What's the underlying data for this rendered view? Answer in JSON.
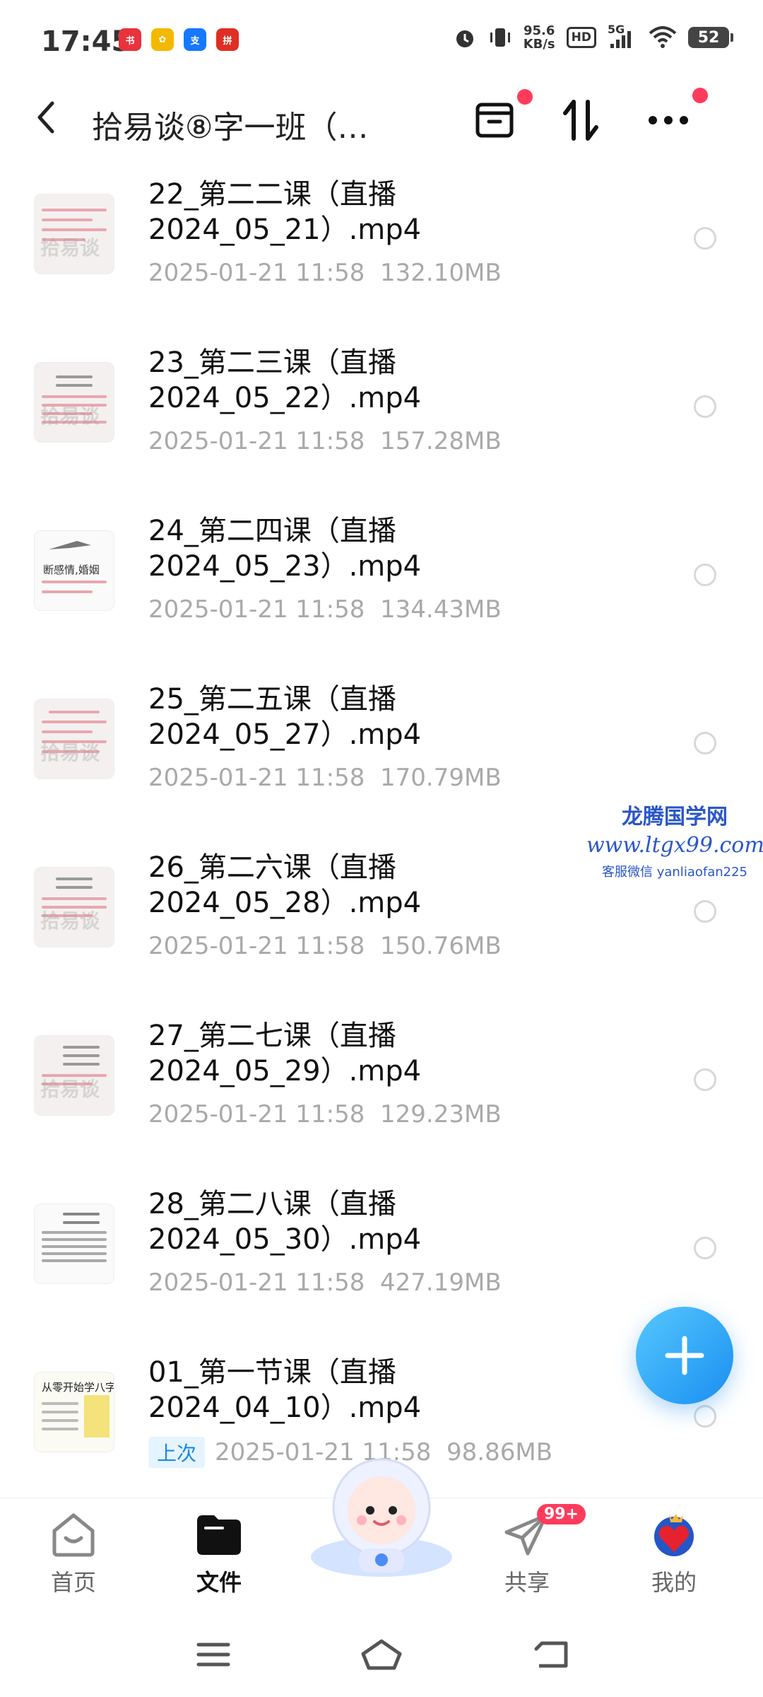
{
  "status": {
    "time": "17:45",
    "speed_value": "95.6",
    "speed_unit": "KB/s",
    "hd": "HD",
    "network": "5G",
    "battery": "52"
  },
  "header": {
    "title": "拾易谈⑧字一班（…"
  },
  "files": [
    {
      "name_line1": "22_第二二课（直播",
      "name_line2": "2024_05_21）.mp4",
      "date": "2025-01-21  11:58",
      "size": "132.10MB"
    },
    {
      "name_line1": "23_第二三课（直播",
      "name_line2": "2024_05_22）.mp4",
      "date": "2025-01-21  11:58",
      "size": "157.28MB"
    },
    {
      "name_line1": "24_第二四课（直播",
      "name_line2": "2024_05_23）.mp4",
      "date": "2025-01-21  11:58",
      "size": "134.43MB"
    },
    {
      "name_line1": "25_第二五课（直播",
      "name_line2": "2024_05_27）.mp4",
      "date": "2025-01-21  11:58",
      "size": "170.79MB"
    },
    {
      "name_line1": "26_第二六课（直播",
      "name_line2": "2024_05_28）.mp4",
      "date": "2025-01-21  11:58",
      "size": "150.76MB"
    },
    {
      "name_line1": "27_第二七课（直播",
      "name_line2": "2024_05_29）.mp4",
      "date": "2025-01-21  11:58",
      "size": "129.23MB"
    },
    {
      "name_line1": "28_第二八课（直播",
      "name_line2": "2024_05_30）.mp4",
      "date": "2025-01-21  11:58",
      "size": "427.19MB"
    },
    {
      "name_line1": "01_第一节课（直播",
      "name_line2": "2024_04_10）.mp4",
      "date": "2025-01-21  11:58",
      "size": "98.86MB",
      "tag": "上次"
    }
  ],
  "thumb_texts": {
    "t24": "断感情,婚姻",
    "t01": "从零开始学八字"
  },
  "watermark": {
    "line1": "龙腾国学网",
    "line2": "www.ltgx99.com",
    "line3": "客服微信 yanliaofan225"
  },
  "nav": {
    "home": "首页",
    "files": "文件",
    "share": "共享",
    "share_badge": "99+",
    "mine": "我的"
  },
  "colors": {
    "accent": "#1a8ff0",
    "badge": "#ff3b5c"
  }
}
